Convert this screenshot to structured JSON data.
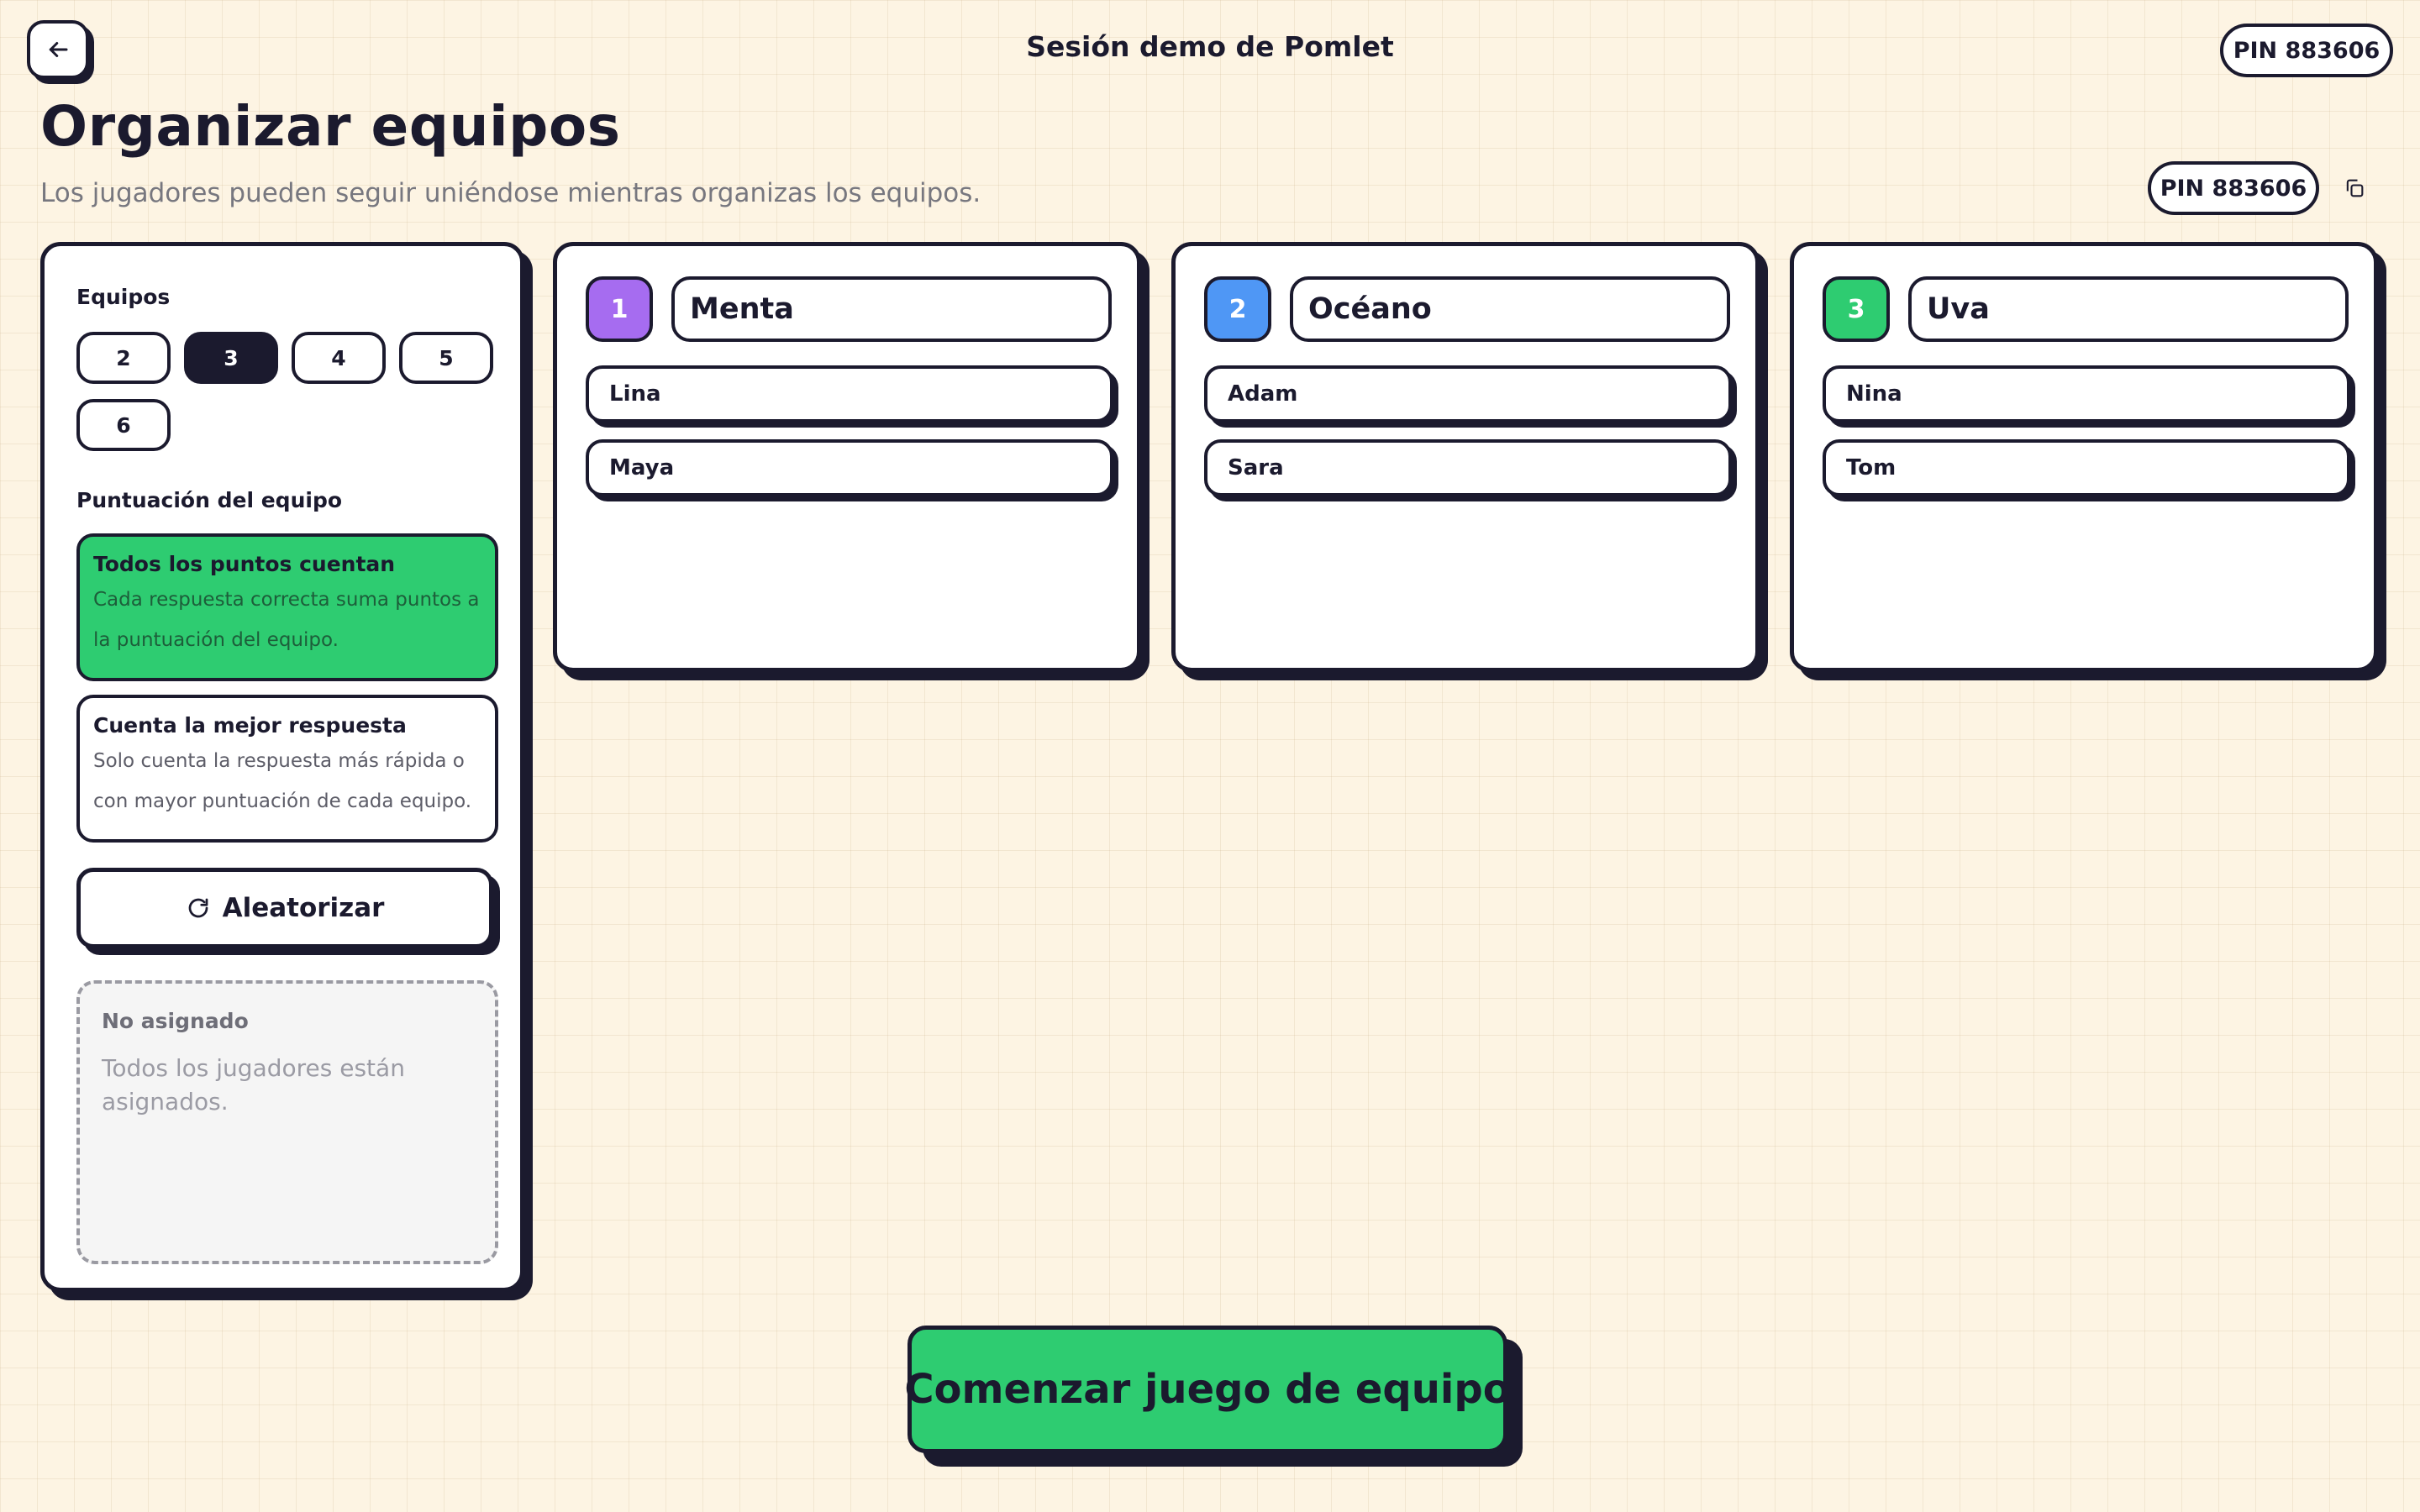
{
  "header": {
    "session_title": "Sesión demo de Pomlet",
    "pin": "PIN 883606"
  },
  "page": {
    "title": "Organizar equipos",
    "subtitle": "Los jugadores pueden seguir uniéndose mientras organizas los equipos.",
    "pin": "PIN 883606"
  },
  "sidebar": {
    "teams_label": "Equipos",
    "team_counts": [
      "2",
      "3",
      "4",
      "5",
      "6"
    ],
    "selected_count": "3",
    "scoring_label": "Puntuación del equipo",
    "modes": [
      {
        "title": "Todos los puntos cuentan",
        "desc": "Cada respuesta correcta suma puntos a la puntuación del equipo.",
        "selected": true
      },
      {
        "title": "Cuenta la mejor respuesta",
        "desc": "Solo cuenta la respuesta más rápida o con mayor puntuación de cada equipo.",
        "selected": false
      }
    ],
    "randomize_label": "Aleatorizar",
    "unassigned_title": "No asignado",
    "unassigned_text": "Todos los jugadores están asignados."
  },
  "teams": [
    {
      "number": "1",
      "name": "Menta",
      "color": "#a66cf0",
      "players": [
        "Lina",
        "Maya"
      ]
    },
    {
      "number": "2",
      "name": "Océano",
      "color": "#4f97f5",
      "players": [
        "Adam",
        "Sara"
      ]
    },
    {
      "number": "3",
      "name": "Uva",
      "color": "#2ecc71",
      "players": [
        "Nina",
        "Tom"
      ]
    }
  ],
  "start_button": "Comenzar juego de equipo",
  "colors": {
    "ink": "#1b1a2e",
    "accent_green": "#2ecc71",
    "background": "#fdf4e3"
  },
  "icons": {
    "back": "arrow-left-icon",
    "copy": "copy-icon",
    "randomize": "refresh-icon"
  }
}
